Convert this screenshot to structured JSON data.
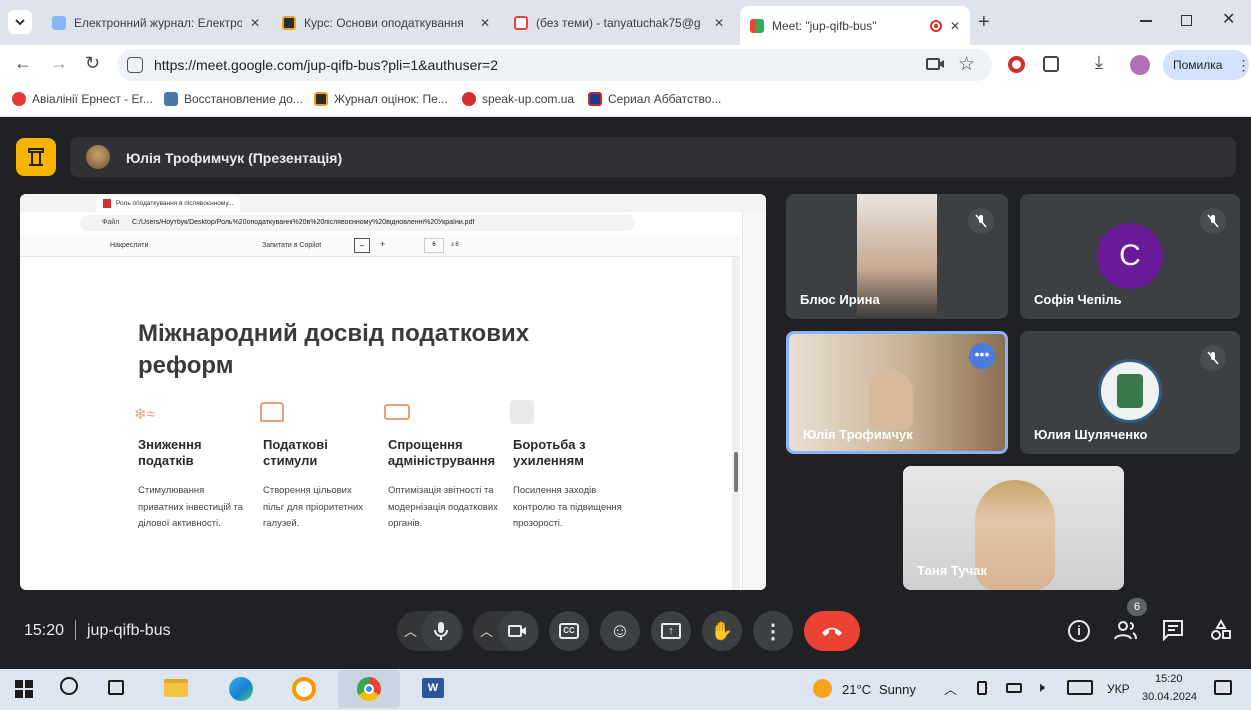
{
  "browser": {
    "tabs": [
      {
        "title": "Електронний журнал: Електро",
        "color": "#8ab4f8"
      },
      {
        "title": "Курс: Основи оподаткування",
        "color": "#e8a317"
      },
      {
        "title": "(без теми) - tanyatuchak75@g",
        "color": "#ea4335"
      },
      {
        "title": "Meet: \"jup-qifb-bus\"",
        "color": "#34a853"
      }
    ],
    "new_tab": "+",
    "url": "https://meet.google.com/jup-qifb-bus?pli=1&authuser=2",
    "error_label": "Помилка",
    "bookmarks": [
      {
        "label": "Авіалінії Ернест - Er...",
        "color": "#e53935"
      },
      {
        "label": "Восстановление до...",
        "color": "#4a76a8"
      },
      {
        "label": "Журнал оцінок: Пе...",
        "color": "#e8a317"
      },
      {
        "label": "speak-up.com.ua",
        "color": "#d32f2f"
      },
      {
        "label": "Сериал Аббатство...",
        "color": "#1e3a8a"
      }
    ]
  },
  "meet": {
    "presenter_banner": "Юлія Трофимчук (Презентація)",
    "meeting_time": "15:20",
    "meeting_code": "jup-qifb-bus",
    "participants_count": "6",
    "participants": [
      {
        "name": "Блюс Ирина"
      },
      {
        "name": "Софія Чепіль",
        "initial": "C",
        "avatar_color": "#6a1b9a"
      },
      {
        "name": "Юлія Трофимчук"
      },
      {
        "name": "Юлия Шуляченко"
      },
      {
        "name": "Таня Тучак"
      }
    ],
    "end_call_color": "#ea4335"
  },
  "shared_screen": {
    "tab_title": "Роль оподаткування в післявоєнному...",
    "file_label": "Файл",
    "path": "C:/Users/Ноутбук/Desktop/Роль%20оподаткуванні%20в%20післявоєнному%20відновленні%20України.pdf",
    "draw_label": "Накреслити",
    "copilot_label": "Запитати в Copilot",
    "page_num": "6",
    "page_total": "з 8",
    "zoom_minus": "–",
    "zoom_plus": "+",
    "heading": "Міжнародний досвід податкових реформ",
    "columns": [
      {
        "title": "Зниження податків",
        "text": "Стимулювання приватних інвестицій та ділової активності."
      },
      {
        "title": "Податкові стимули",
        "text": "Створення цільових пільг для пріоритетних галузей."
      },
      {
        "title": "Спрощення адміністрування",
        "text": "Оптимізація звітності та модернізація податкових органів."
      },
      {
        "title": "Боротьба з ухиленням",
        "text": "Посилення заходів контролю та підвищення прозорості."
      }
    ]
  },
  "taskbar": {
    "weather_temp": "21°C",
    "weather_text": "Sunny",
    "lang": "УКР",
    "time": "15:20",
    "date": "30.04.2024"
  }
}
